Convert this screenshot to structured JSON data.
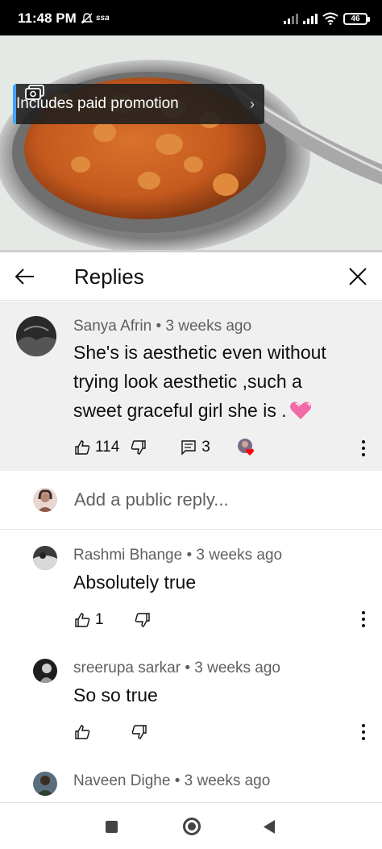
{
  "status_bar": {
    "time": "11:48 PM",
    "network_label": "ssa",
    "battery": "46"
  },
  "video": {
    "promo_label": "Includes paid promotion",
    "progress_fraction": 0.0
  },
  "replies_header": {
    "title": "Replies",
    "back_icon": "back-arrow-icon",
    "close_icon": "close-icon"
  },
  "parent_comment": {
    "author": "Sanya Afrin",
    "time": "3 weeks ago",
    "text_lines": [
      "She's is aesthetic even without",
      "trying look aesthetic ,such a",
      "sweet graceful girl she is ."
    ],
    "likes": "114",
    "replies_count": "3"
  },
  "add_reply": {
    "placeholder": "Add a public reply..."
  },
  "replies": [
    {
      "author": "Rashmi Bhange",
      "time": "3 weeks ago",
      "text": "Absolutely true",
      "likes": "1"
    },
    {
      "author": "sreerupa sarkar",
      "time": "3 weeks ago",
      "text": "So so true",
      "likes": ""
    },
    {
      "author": "Naveen Dighe",
      "time": "3 weeks ago",
      "text": "",
      "likes": ""
    }
  ],
  "colors": {
    "accent_blue": "#3ea6ff",
    "progress_red": "#ff0000",
    "meta_gray": "#606060",
    "highlight_bg": "#f0f0f0"
  }
}
